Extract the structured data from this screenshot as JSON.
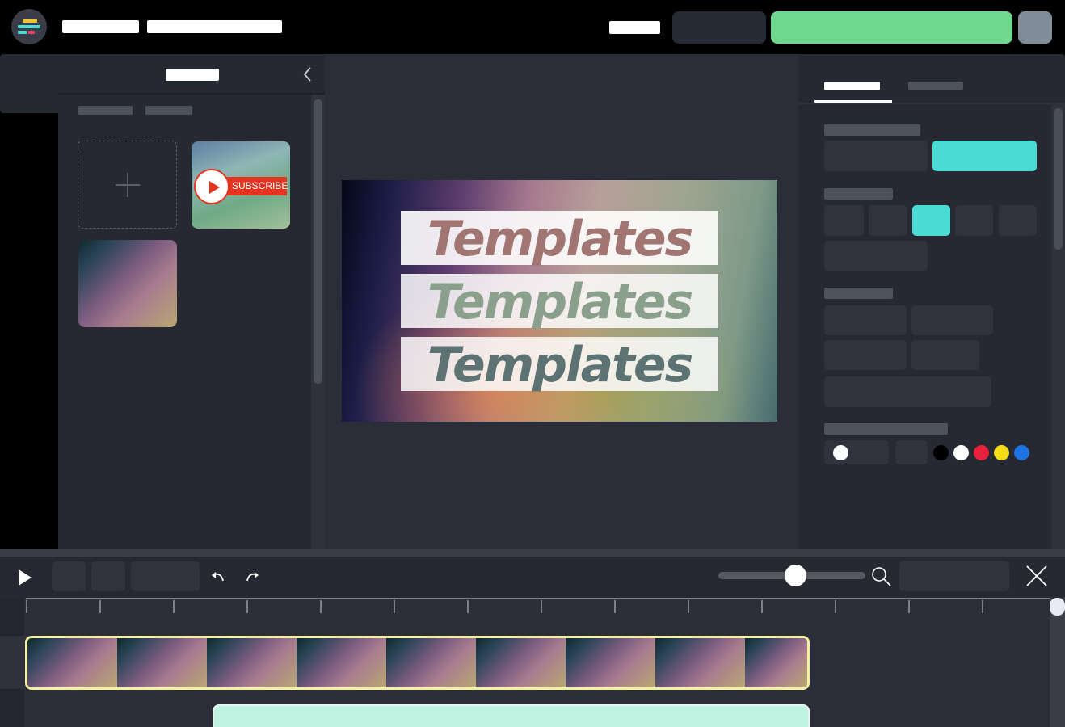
{
  "canvas": {
    "template_lines": [
      {
        "text": "Templates",
        "color": "#a07572"
      },
      {
        "text": "Templates",
        "color": "#8ba08c"
      },
      {
        "text": "Templates",
        "color": "#5d7272"
      }
    ]
  },
  "assets": {
    "subscribe_label": "SUBSCRIBE"
  },
  "colors": {
    "accent_teal": "#4adbd5",
    "primary_green": "#6ed88f",
    "swatches": [
      "#000000",
      "#ffffff",
      "#e8213e",
      "#f5de15",
      "#1e73e3"
    ]
  },
  "timeline": {
    "zoom_level": 0.5,
    "clip_frames": 9
  }
}
